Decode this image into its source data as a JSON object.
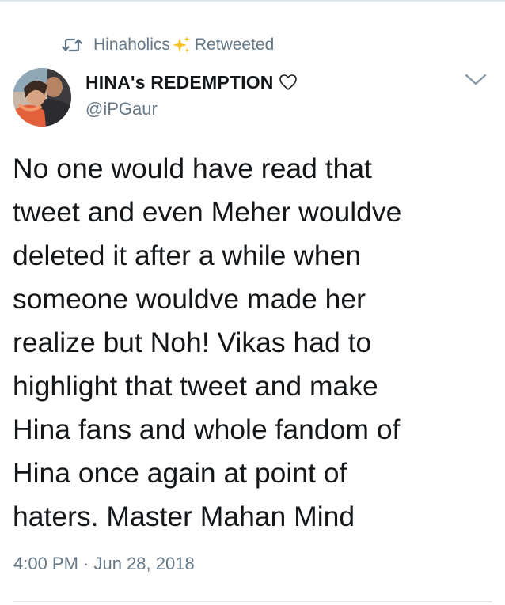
{
  "retweet": {
    "retweeter": "Hinaholics",
    "emoji": "sparkles",
    "label": "Retweeted",
    "icon": "retweet-icon"
  },
  "author": {
    "name": "HINA's REDEMPTION",
    "name_emoji": "white-heart",
    "handle": "@iPGaur",
    "avatar_icon": "avatar-photo"
  },
  "menu": {
    "icon": "chevron-down-icon"
  },
  "tweet": {
    "lines": [
      "No one would have read that",
      "tweet and even Meher wouldve",
      "deleted it after a while when",
      "someone wouldve made her",
      "realize but Noh! Vikas had to",
      "highlight that tweet and make",
      "Hina fans and whole fandom of",
      "Hina once again at point of",
      "haters. Master Mahan Mind"
    ]
  },
  "timestamp": "4:00 PM · Jun 28, 2018",
  "colors": {
    "text_primary": "#14171a",
    "text_secondary": "#657786",
    "divider": "#e1e8ed",
    "sparkle": "#f7c325"
  }
}
